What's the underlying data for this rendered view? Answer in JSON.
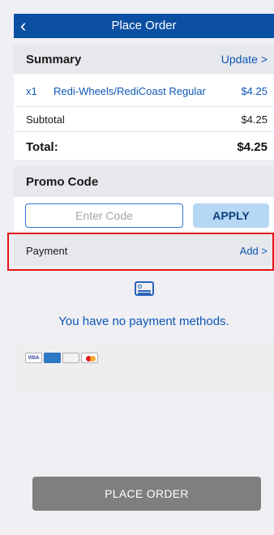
{
  "header": {
    "title": "Place Order",
    "back_icon": "chevron-left-icon",
    "back_glyph": "‹"
  },
  "summary": {
    "label": "Summary",
    "action": "Update >",
    "items": [
      {
        "qty": "x1",
        "name": "Redi-Wheels/RediCoast Regular",
        "price": "$4.25"
      }
    ],
    "subtotal_label": "Subtotal",
    "subtotal_value": "$4.25",
    "total_label": "Total:",
    "total_value": "$4.25"
  },
  "promo": {
    "label": "Promo Code",
    "input_placeholder": "Enter Code",
    "input_value": "",
    "apply_label": "APPLY"
  },
  "payment": {
    "label": "Payment",
    "action": "Add >",
    "icon": "credit-card-icon",
    "empty_text": "You have no payment methods.",
    "card_logos": [
      "VISA",
      "AMERICAN EXPRESS",
      "DISCOVER",
      "MasterCard"
    ]
  },
  "footer": {
    "place_order_label": "PLACE ORDER"
  },
  "colors": {
    "header_bg": "#0b4fa2",
    "link_blue": "#0c57b5",
    "apply_bg": "#b7d8f4",
    "highlight_red": "#e41414",
    "place_order_bg": "#7f7f7f"
  }
}
